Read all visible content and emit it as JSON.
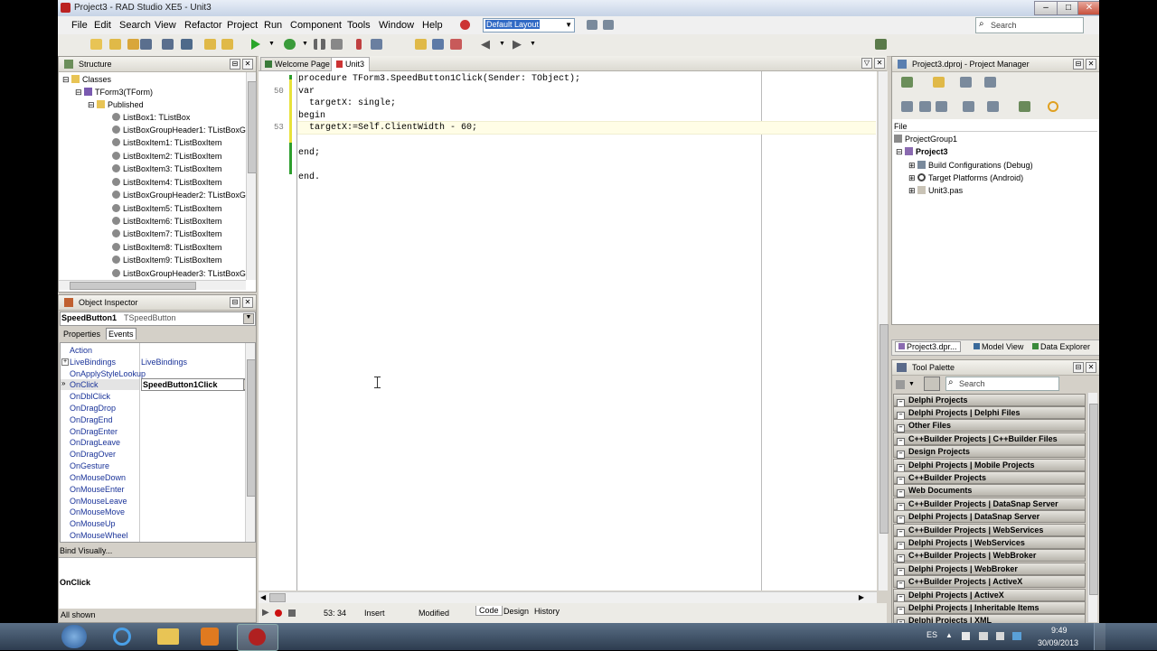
{
  "window": {
    "title": "Project3 - RAD Studio XE5 - Unit3"
  },
  "menu": [
    "File",
    "Edit",
    "Search",
    "View",
    "Refactor",
    "Project",
    "Run",
    "Component",
    "Tools",
    "Window",
    "Help"
  ],
  "toolbar": {
    "layout": "Default Layout",
    "search_placeholder": "Search"
  },
  "structure": {
    "title": "Structure",
    "classes": "Classes",
    "form": "TForm3(TForm)",
    "published": "Published",
    "items": [
      "ListBox1: TListBox",
      "ListBoxGroupHeader1: TListBoxGr",
      "ListBoxItem1: TListBoxItem",
      "ListBoxItem2: TListBoxItem",
      "ListBoxItem3: TListBoxItem",
      "ListBoxItem4: TListBoxItem",
      "ListBoxGroupHeader2: TListBoxGr",
      "ListBoxItem5: TListBoxItem",
      "ListBoxItem6: TListBoxItem",
      "ListBoxItem7: TListBoxItem",
      "ListBoxItem8: TListBoxItem",
      "ListBoxItem9: TListBoxItem",
      "ListBoxGroupHeader3: TListBoxGr"
    ]
  },
  "inspector": {
    "title": "Object Inspector",
    "object_name": "SpeedButton1",
    "object_type": "TSpeedButton",
    "tabs": [
      "Properties",
      "Events"
    ],
    "events": [
      {
        "name": "Action",
        "value": ""
      },
      {
        "name": "LiveBindings",
        "value": "LiveBindings"
      },
      {
        "name": "OnApplyStyleLookup",
        "value": ""
      },
      {
        "name": "OnClick",
        "value": "SpeedButton1Click"
      },
      {
        "name": "OnDblClick",
        "value": ""
      },
      {
        "name": "OnDragDrop",
        "value": ""
      },
      {
        "name": "OnDragEnd",
        "value": ""
      },
      {
        "name": "OnDragEnter",
        "value": ""
      },
      {
        "name": "OnDragLeave",
        "value": ""
      },
      {
        "name": "OnDragOver",
        "value": ""
      },
      {
        "name": "OnGesture",
        "value": ""
      },
      {
        "name": "OnMouseDown",
        "value": ""
      },
      {
        "name": "OnMouseEnter",
        "value": ""
      },
      {
        "name": "OnMouseLeave",
        "value": ""
      },
      {
        "name": "OnMouseMove",
        "value": ""
      },
      {
        "name": "OnMouseUp",
        "value": ""
      },
      {
        "name": "OnMouseWheel",
        "value": ""
      }
    ],
    "bind_visually": "Bind Visually...",
    "selected_event": "OnClick",
    "status": "All shown"
  },
  "editor": {
    "tabs": [
      "Welcome Page",
      "Unit3"
    ],
    "lines": [
      {
        "no": "",
        "text": "procedure TForm3.SpeedButton1Click(Sender: TObject);"
      },
      {
        "no": "50",
        "text": "var"
      },
      {
        "no": "",
        "text": "  targetX: single;"
      },
      {
        "no": "",
        "text": "begin"
      },
      {
        "no": "53",
        "text": "  targetX:=Self.ClientWidth - 60;"
      },
      {
        "no": "",
        "text": ""
      },
      {
        "no": "",
        "text": "end;"
      },
      {
        "no": "",
        "text": ""
      },
      {
        "no": "",
        "text": "end."
      }
    ],
    "status": {
      "position": "53: 34",
      "mode": "Insert",
      "modified": "Modified",
      "tabs": [
        "Code",
        "Design",
        "History"
      ]
    }
  },
  "project_manager": {
    "title": "Project3.dproj - Project Manager",
    "file_label": "File",
    "group": "ProjectGroup1",
    "project": "Project3",
    "nodes": [
      "Build Configurations (Debug)",
      "Target Platforms (Android)",
      "Unit3.pas"
    ],
    "bottom_tabs": [
      "Project3.dpr...",
      "Model View",
      "Data Explorer"
    ]
  },
  "tool_palette": {
    "title": "Tool Palette",
    "search_placeholder": "Search",
    "categories": [
      "Delphi Projects",
      "Delphi Projects | Delphi Files",
      "Other Files",
      "C++Builder Projects | C++Builder Files",
      "Design Projects",
      "Delphi Projects | Mobile Projects",
      "C++Builder Projects",
      "Web Documents",
      "C++Builder Projects | DataSnap Server",
      "Delphi Projects | DataSnap Server",
      "C++Builder Projects | WebServices",
      "Delphi Projects | WebServices",
      "C++Builder Projects | WebBroker",
      "Delphi Projects | WebBroker",
      "C++Builder Projects | ActiveX",
      "Delphi Projects | ActiveX",
      "Delphi Projects | Inheritable Items",
      "Delphi Projects | XML"
    ]
  },
  "taskbar": {
    "lang": "ES",
    "time": "9:49",
    "date": "30/09/2013"
  }
}
